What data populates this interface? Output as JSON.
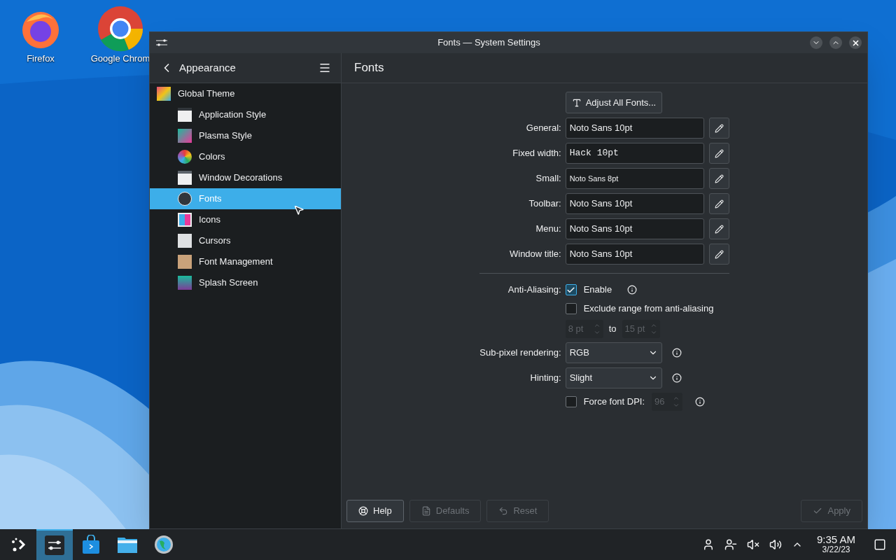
{
  "desktop": {
    "icons": [
      {
        "label": "Firefox"
      },
      {
        "label": "Google Chrom"
      }
    ]
  },
  "window": {
    "title": "Fonts — System Settings",
    "sidebar": {
      "header": "Appearance",
      "items": [
        {
          "label": "Global Theme",
          "selected": false,
          "children": [
            {
              "label": "Application Style",
              "selected": false
            },
            {
              "label": "Plasma Style",
              "selected": false
            },
            {
              "label": "Colors",
              "selected": false
            },
            {
              "label": "Window Decorations",
              "selected": false
            },
            {
              "label": "Fonts",
              "selected": true
            },
            {
              "label": "Icons",
              "selected": false
            },
            {
              "label": "Cursors",
              "selected": false
            },
            {
              "label": "Font Management",
              "selected": false
            },
            {
              "label": "Splash Screen",
              "selected": false
            }
          ]
        }
      ]
    },
    "page": {
      "title": "Fonts",
      "adjust_button": "Adjust All Fonts...",
      "font_rows": [
        {
          "label": "General:",
          "value": "Noto Sans 10pt",
          "kind": "normal"
        },
        {
          "label": "Fixed width:",
          "value": "Hack 10pt",
          "kind": "mono"
        },
        {
          "label": "Small:",
          "value": "Noto Sans 8pt",
          "kind": "small"
        },
        {
          "label": "Toolbar:",
          "value": "Noto Sans 10pt",
          "kind": "normal"
        },
        {
          "label": "Menu:",
          "value": "Noto Sans 10pt",
          "kind": "normal"
        },
        {
          "label": "Window title:",
          "value": "Noto Sans 10pt",
          "kind": "normal"
        }
      ],
      "anti_aliasing": {
        "label": "Anti-Aliasing:",
        "enable": {
          "label": "Enable",
          "checked": true
        },
        "exclude": {
          "label": "Exclude range from anti-aliasing",
          "checked": false
        },
        "range_from": {
          "value": "8 pt",
          "disabled": true
        },
        "range_separator": "to",
        "range_to": {
          "value": "15 pt",
          "disabled": true
        }
      },
      "subpixel": {
        "label": "Sub-pixel rendering:",
        "value": "RGB"
      },
      "hinting": {
        "label": "Hinting:",
        "value": "Slight"
      },
      "force_dpi": {
        "label": "Force font DPI:",
        "checked": false,
        "value": {
          "value": "96",
          "disabled": true
        }
      },
      "footer_buttons": [
        {
          "label": "Help",
          "disabled": false
        },
        {
          "label": "Defaults",
          "disabled": true
        },
        {
          "label": "Reset",
          "disabled": true
        }
      ],
      "apply_button": {
        "label": "Apply",
        "disabled": true
      }
    }
  },
  "taskbar": {
    "items": [
      {
        "selected": false
      },
      {
        "selected": true
      },
      {
        "selected": false
      },
      {
        "selected": false
      },
      {
        "selected": false
      }
    ],
    "clock": {
      "time": "9:35 AM",
      "date": "3/22/23"
    }
  }
}
